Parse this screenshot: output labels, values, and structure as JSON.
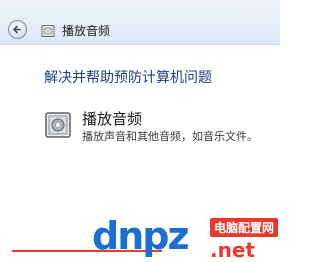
{
  "titlebar": {
    "back_icon": "back-arrow-icon",
    "title_icon": "control-panel-icon",
    "title": "播放音频"
  },
  "main": {
    "heading": "解决并帮助预防计算机问题",
    "item": {
      "icon": "audio-device-icon",
      "title": "播放音频",
      "description": "播放声音和其他音频，如音乐文件。"
    }
  },
  "watermark": {
    "logo_text": "dnpz",
    "site_name": "电脑配置网",
    "domain": ".net"
  },
  "colors": {
    "heading": "#1e3e8a",
    "watermark_blue": "#1c6fd0",
    "watermark_red": "#e8392f"
  }
}
